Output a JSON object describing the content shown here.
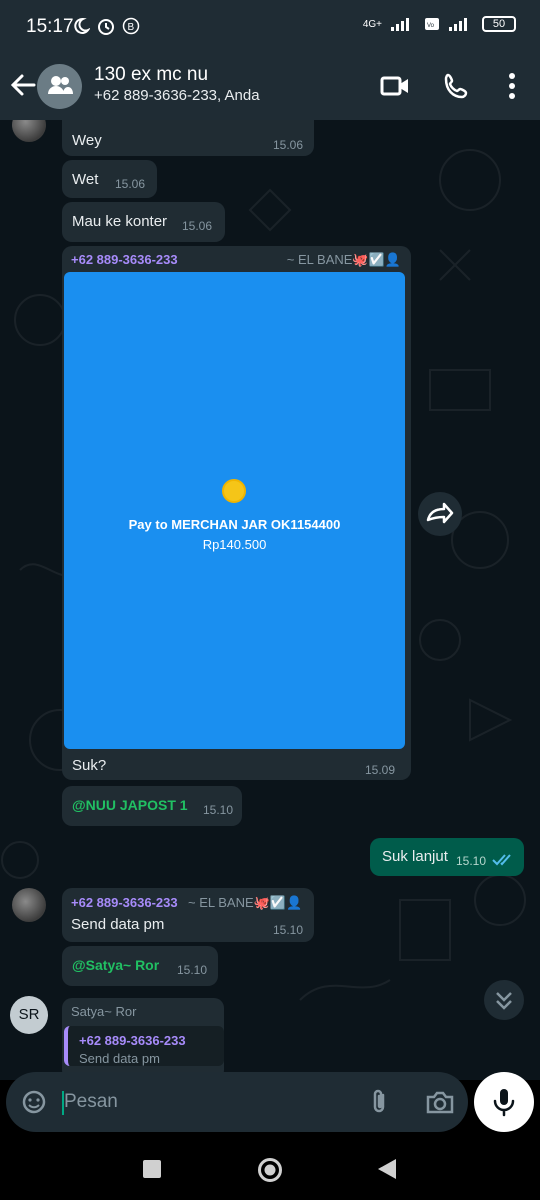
{
  "status_bar": {
    "time": "15:17",
    "network": "4G+",
    "battery": "50"
  },
  "header": {
    "title": "130 ex mc nu",
    "subtitle": "+62 889-3636-233, Anda"
  },
  "messages": [
    {
      "text": "Wey",
      "time": "15.06"
    },
    {
      "text": "Wet",
      "time": "15.06"
    },
    {
      "text": "Mau ke konter",
      "time": "15.06"
    },
    {
      "sender": "+62 889-3636-233",
      "sender_name": "~ EL BANE🐙☑️👤",
      "image": {
        "pay_text": "Pay to MERCHAN JAR OK1154400",
        "amount": "Rp140.500"
      },
      "text": "Suk?",
      "time": "15.09"
    },
    {
      "mention": "@NUU JAPOST 1",
      "time": "15.10"
    },
    {
      "text": "Suk lanjut",
      "time": "15.10",
      "outgoing": true
    },
    {
      "sender": "+62 889-3636-233",
      "sender_name": "~ EL BANE🐙☑️👤",
      "text": "Send data pm",
      "time": "15.10"
    },
    {
      "mention": "@Satya~ Ror",
      "time": "15.10"
    },
    {
      "sender_name": "Satya~ Ror",
      "avatar_initials": "SR",
      "quote": {
        "sender": "+62 889-3636-233",
        "text": "Send data pm"
      }
    }
  ],
  "composer": {
    "placeholder": "Pesan"
  }
}
